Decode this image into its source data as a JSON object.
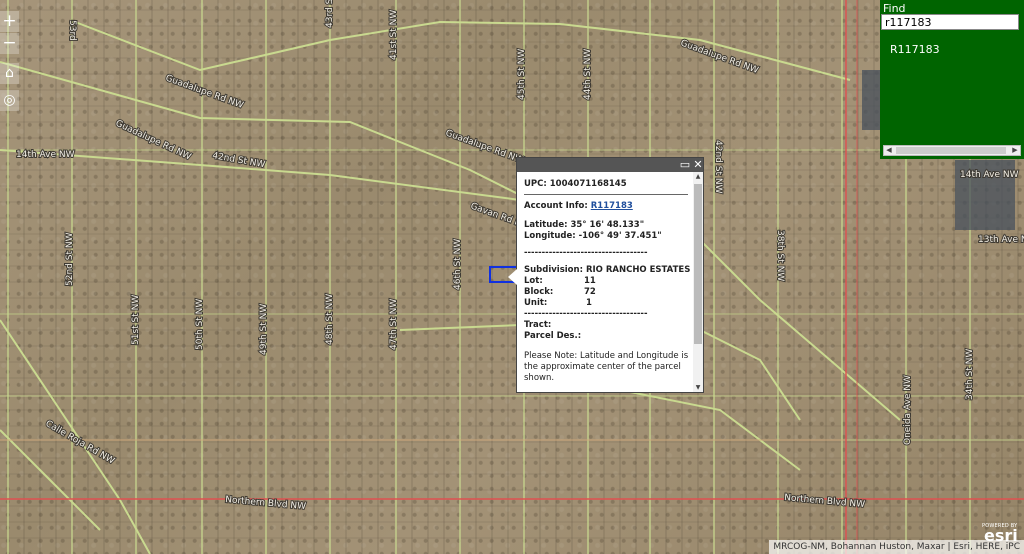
{
  "map": {
    "road_labels": [
      {
        "text": "53rd",
        "id": "road-label-53rd"
      },
      {
        "text": "Guadalupe Rd NW",
        "id": "road-label-guadalupe-1"
      },
      {
        "text": "Guadalupe Rd NW",
        "id": "road-label-guadalupe-2"
      },
      {
        "text": "Guadalupe Rd NW",
        "id": "road-label-guadalupe-3"
      },
      {
        "text": "Guadalupe Rd NW",
        "id": "road-label-guadalupe-4"
      },
      {
        "text": "14th Ave NW",
        "id": "road-label-14th-ave-w"
      },
      {
        "text": "14th Ave NW",
        "id": "road-label-14th-ave-e"
      },
      {
        "text": "13th Ave NW",
        "id": "road-label-13th-ave"
      },
      {
        "text": "42nd St NW",
        "id": "road-label-42nd-st"
      },
      {
        "text": "42nd St NW",
        "id": "road-label-42nd-st-2"
      },
      {
        "text": "Gavan Rd NW",
        "id": "road-label-gavan"
      },
      {
        "text": "Northern Blvd NW",
        "id": "road-label-northern-w"
      },
      {
        "text": "Northern Blvd NW",
        "id": "road-label-northern-e"
      },
      {
        "text": "52nd St NW",
        "id": "road-label-52nd"
      },
      {
        "text": "51st St NW",
        "id": "road-label-51st"
      },
      {
        "text": "50th St NW",
        "id": "road-label-50th"
      },
      {
        "text": "49th St NW",
        "id": "road-label-49th"
      },
      {
        "text": "48th St NW",
        "id": "road-label-48th"
      },
      {
        "text": "47th St NW",
        "id": "road-label-47th"
      },
      {
        "text": "46th St NW",
        "id": "road-label-46th"
      },
      {
        "text": "45th St NW",
        "id": "road-label-45th"
      },
      {
        "text": "44th St NW",
        "id": "road-label-44th"
      },
      {
        "text": "43rd St NW",
        "id": "road-label-43rd"
      },
      {
        "text": "41st St NW",
        "id": "road-label-41st"
      },
      {
        "text": "38th St NW",
        "id": "road-label-38th"
      },
      {
        "text": "Calle Roja Rd NW",
        "id": "road-label-calle-roja"
      },
      {
        "text": "Oneida Ave NW",
        "id": "road-label-oneida"
      },
      {
        "text": "34th St NW",
        "id": "road-label-34th"
      }
    ]
  },
  "controls": {
    "zoom_in": "+",
    "zoom_out": "−",
    "home": "⌂",
    "locate": "◎"
  },
  "find": {
    "title": "Find",
    "input_value": "r117183",
    "result": "R117183",
    "scroll_left": "◀",
    "scroll_right": "▶"
  },
  "popup": {
    "maximize": "▭",
    "close": "✕",
    "upc_label": "UPC:",
    "upc_value": "1004071168145",
    "account_label": "Account Info:",
    "account_value": "R117183",
    "lat_label": "Latitude:",
    "lat_value": "35° 16' 48.133\"",
    "lon_label": "Longitude:",
    "lon_value": "-106° 49' 37.451\"",
    "separator": "-----------------------------------",
    "subdivision_label": "Subdivision:",
    "subdivision_value": "RIO RANCHO ESTATES",
    "lot_label": "Lot:",
    "lot_value": "11",
    "block_label": "Block:",
    "block_value": "72",
    "unit_label": "Unit:",
    "unit_value": "1",
    "tract_label": "Tract:",
    "parcel_des_label": "Parcel Des.:",
    "note": "Please Note: Latitude and Longitude is the approximate center of the parcel shown.",
    "scroll_up": "▲",
    "scroll_down": "▼"
  },
  "attribution": "MRCOG-NM, Bohannan Huston, Maxar | Esri, HERE, iPC",
  "logo": {
    "small": "POWERED BY",
    "big": "esri"
  },
  "colors": {
    "find_panel_bg": "#006400",
    "selected_parcel": "#1030e0",
    "boundary_line": "#e05050",
    "street_line": "#c9d98f"
  }
}
